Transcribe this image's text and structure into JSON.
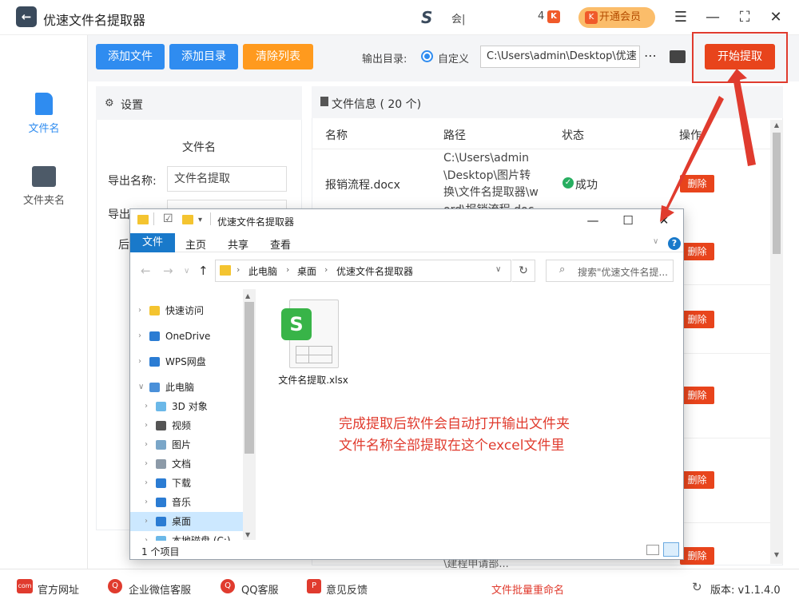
{
  "app": {
    "title": "优速文件名提取器",
    "logo": "←",
    "user_avatar": "S",
    "user_name": "会|",
    "msg_count": "4",
    "msg_badge": "K",
    "vip_label": "开通会员",
    "menu_icon": "☰",
    "min_icon": "—",
    "max_icon": "⛶",
    "close_icon": "✕"
  },
  "sidebar": {
    "items": [
      {
        "label": "文件名",
        "icon": "file-icon"
      },
      {
        "label": "文件夹名",
        "icon": "folder-icon"
      }
    ]
  },
  "toolbar": {
    "add_file": "添加文件",
    "add_dir": "添加目录",
    "clear_list": "清除列表",
    "output_label": "输出目录:",
    "radio_custom": "自定义",
    "output_path": "C:\\Users\\admin\\Desktop\\优速",
    "more": "⋯",
    "start": "开始提取"
  },
  "settings": {
    "icon": "⚙",
    "title": "设置",
    "subtitle": "文件名",
    "export_name_label": "导出名称:",
    "export_name_value": "文件名提取",
    "export_type_label": "导出",
    "suffix_label": "后"
  },
  "files": {
    "title": "文件信息 ( 20 个)",
    "columns": [
      "名称",
      "路径",
      "状态",
      "操作"
    ],
    "rows": [
      {
        "name": "报销流程.docx",
        "path": "C:\\Users\\admin\\Desktop\\图片转换\\文件名提取器\\word\\报销流程.docx",
        "status": "成功",
        "status_icon": "✓"
      }
    ],
    "delete_label": "删除",
    "partial_row_path": "\\建程申请部...",
    "scroll_up": "▲",
    "scroll_down": "▼"
  },
  "footer": {
    "site": "官方网址",
    "wechat": "企业微信客服",
    "qq": "QQ客服",
    "feedback": "意见反馈",
    "rename_link": "文件批量重命名",
    "refresh_icon": "↻",
    "version": "版本: v1.1.4.0",
    "icons": {
      "site": "com",
      "wechat": "Q",
      "qq": "Q",
      "feedback": "P"
    }
  },
  "explorer": {
    "title": "优速文件名提取器",
    "qat_check": "☑",
    "qat_drop": "▾",
    "tabs": {
      "file": "文件",
      "home": "主页",
      "share": "共享",
      "view": "查看"
    },
    "help": "?",
    "ribbon_expand": "∨",
    "min_icon": "—",
    "max_icon": "☐",
    "close_icon": "✕",
    "nav_back": "←",
    "nav_forward": "→",
    "nav_recent": "∨",
    "nav_up": "↑",
    "breadcrumb": [
      "此电脑",
      "桌面",
      "优速文件名提取器"
    ],
    "crumb_sep": "›",
    "addr_drop": "∨",
    "refresh": "↻",
    "search_icon": "⌕",
    "search_placeholder": "搜索\"优速文件名提...",
    "nav_items": [
      {
        "label": "快速访问",
        "chev": "›",
        "color": "#f4c430"
      },
      {
        "label": "OneDrive",
        "chev": "›",
        "color": "#2b7cd3"
      },
      {
        "label": "WPS网盘",
        "chev": "›",
        "color": "#2b7cd3"
      },
      {
        "label": "此电脑",
        "chev": "∨",
        "color": "#4a90d9"
      },
      {
        "label": "3D 对象",
        "chev": "›",
        "color": "#6bb8e8"
      },
      {
        "label": "视频",
        "chev": "›",
        "color": "#555555"
      },
      {
        "label": "图片",
        "chev": "›",
        "color": "#7aa6c8"
      },
      {
        "label": "文档",
        "chev": "›",
        "color": "#8c9aa8"
      },
      {
        "label": "下载",
        "chev": "›",
        "color": "#2b7cd3"
      },
      {
        "label": "音乐",
        "chev": "›",
        "color": "#2b7cd3"
      },
      {
        "label": "桌面",
        "chev": "›",
        "color": "#2b7cd3"
      },
      {
        "label": "本地磁盘 (C:)",
        "chev": "›",
        "color": "#6bb8e8"
      }
    ],
    "file_name": "文件名提取.xlsx",
    "file_badge": "S",
    "status_count": "1 个项目",
    "scroll_up": "▲",
    "scroll_down": "▼"
  },
  "annotation": {
    "line1": "完成提取后软件会自动打开输出文件夹",
    "line2": "文件名称全部提取在这个excel文件里",
    "color": "#e03b2e"
  }
}
